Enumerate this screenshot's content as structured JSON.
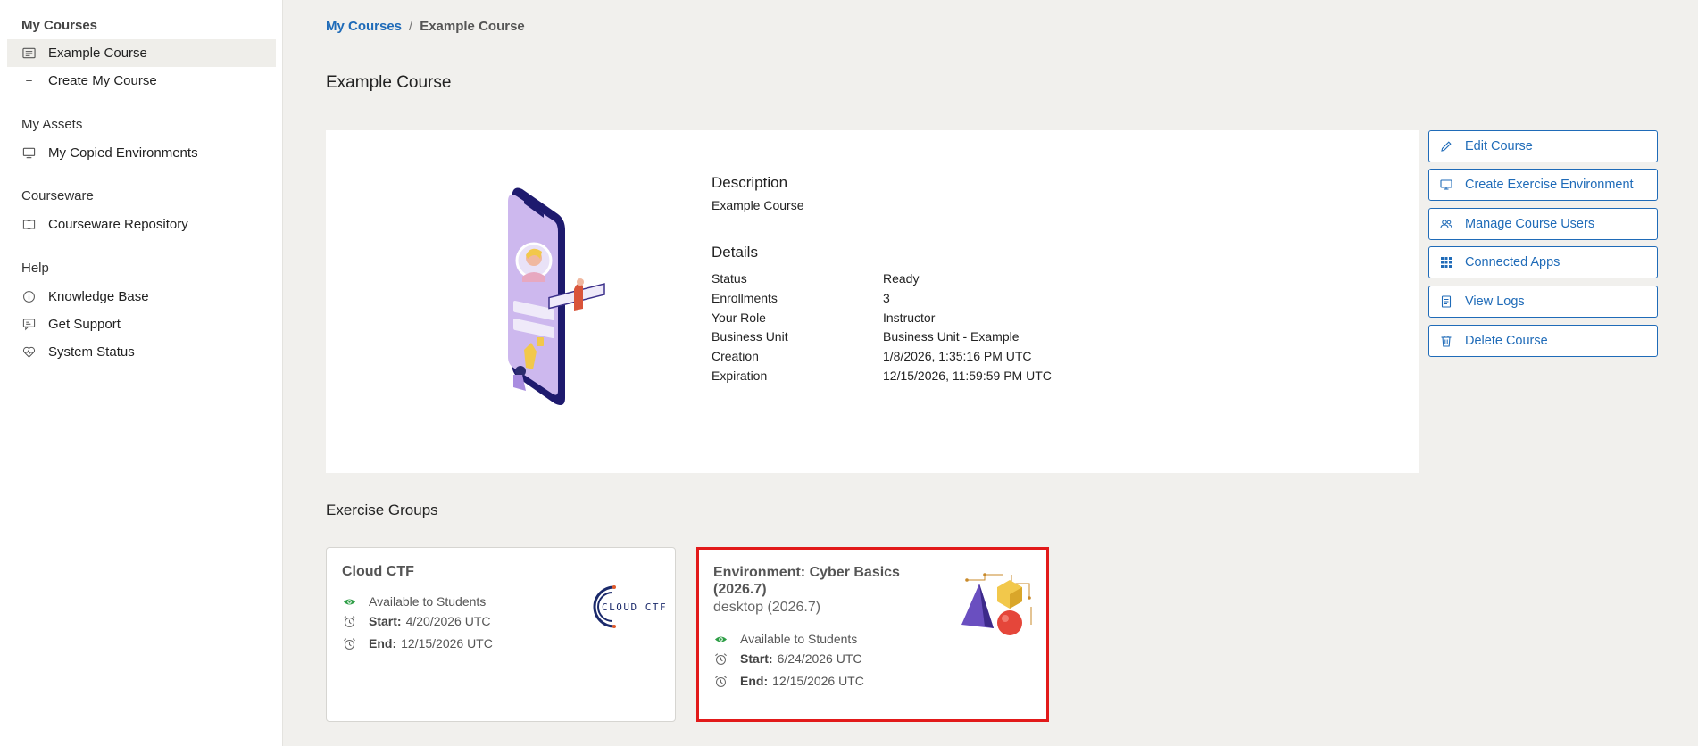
{
  "sidebar": {
    "sections": [
      {
        "title": "My Courses",
        "items": [
          {
            "label": "Example Course",
            "icon": "list-icon",
            "active": true
          },
          {
            "label": "Create My Course",
            "icon": "plus-icon"
          }
        ]
      },
      {
        "title": "My Assets",
        "items": [
          {
            "label": "My Copied Environments",
            "icon": "monitor-icon"
          }
        ]
      },
      {
        "title": "Courseware",
        "items": [
          {
            "label": "Courseware Repository",
            "icon": "book-icon"
          }
        ]
      },
      {
        "title": "Help",
        "items": [
          {
            "label": "Knowledge Base",
            "icon": "info-icon"
          },
          {
            "label": "Get Support",
            "icon": "chat-icon"
          },
          {
            "label": "System Status",
            "icon": "heartbeat-icon"
          }
        ]
      }
    ]
  },
  "breadcrumb": {
    "parent": "My Courses",
    "separator": "/",
    "current": "Example Course"
  },
  "page_title": "Example Course",
  "course": {
    "description_heading": "Description",
    "description": "Example Course",
    "details_heading": "Details",
    "details": [
      {
        "label": "Status",
        "value": "Ready"
      },
      {
        "label": "Enrollments",
        "value": "3"
      },
      {
        "label": "Your Role",
        "value": "Instructor"
      },
      {
        "label": "Business Unit",
        "value": "Business Unit - Example"
      },
      {
        "label": "Creation",
        "value": "1/8/2026, 1:35:16 PM UTC"
      },
      {
        "label": "Expiration",
        "value": "12/15/2026, 11:59:59 PM UTC"
      }
    ]
  },
  "actions": [
    {
      "label": "Edit Course",
      "icon": "pencil-icon"
    },
    {
      "label": "Create Exercise Environment",
      "icon": "monitor-icon"
    },
    {
      "label": "Manage Course Users",
      "icon": "users-icon"
    },
    {
      "label": "Connected Apps",
      "icon": "grid-icon"
    },
    {
      "label": "View Logs",
      "icon": "document-icon"
    },
    {
      "label": "Delete Course",
      "icon": "trash-icon"
    }
  ],
  "exercise_groups": {
    "title": "Exercise Groups",
    "cards": [
      {
        "title": "Cloud CTF",
        "availability": "Available to Students",
        "start_label": "Start:",
        "start": "4/20/2026 UTC",
        "end_label": "End:",
        "end": "12/15/2026 UTC",
        "logo_text": "CLOUD CTF"
      },
      {
        "title_line1": "Environment: Cyber Basics",
        "title_line2": "(2026.7)",
        "subtitle": "desktop (2026.7)",
        "availability": "Available to Students",
        "start_label": "Start:",
        "start": "6/24/2026 UTC",
        "end_label": "End:",
        "end": "12/15/2026 UTC",
        "highlighted": true
      }
    ]
  },
  "colors": {
    "link": "#1f6bb8",
    "highlight": "#e21a1a",
    "available": "#2e9e46",
    "sidebar_active": "#efeeea"
  }
}
